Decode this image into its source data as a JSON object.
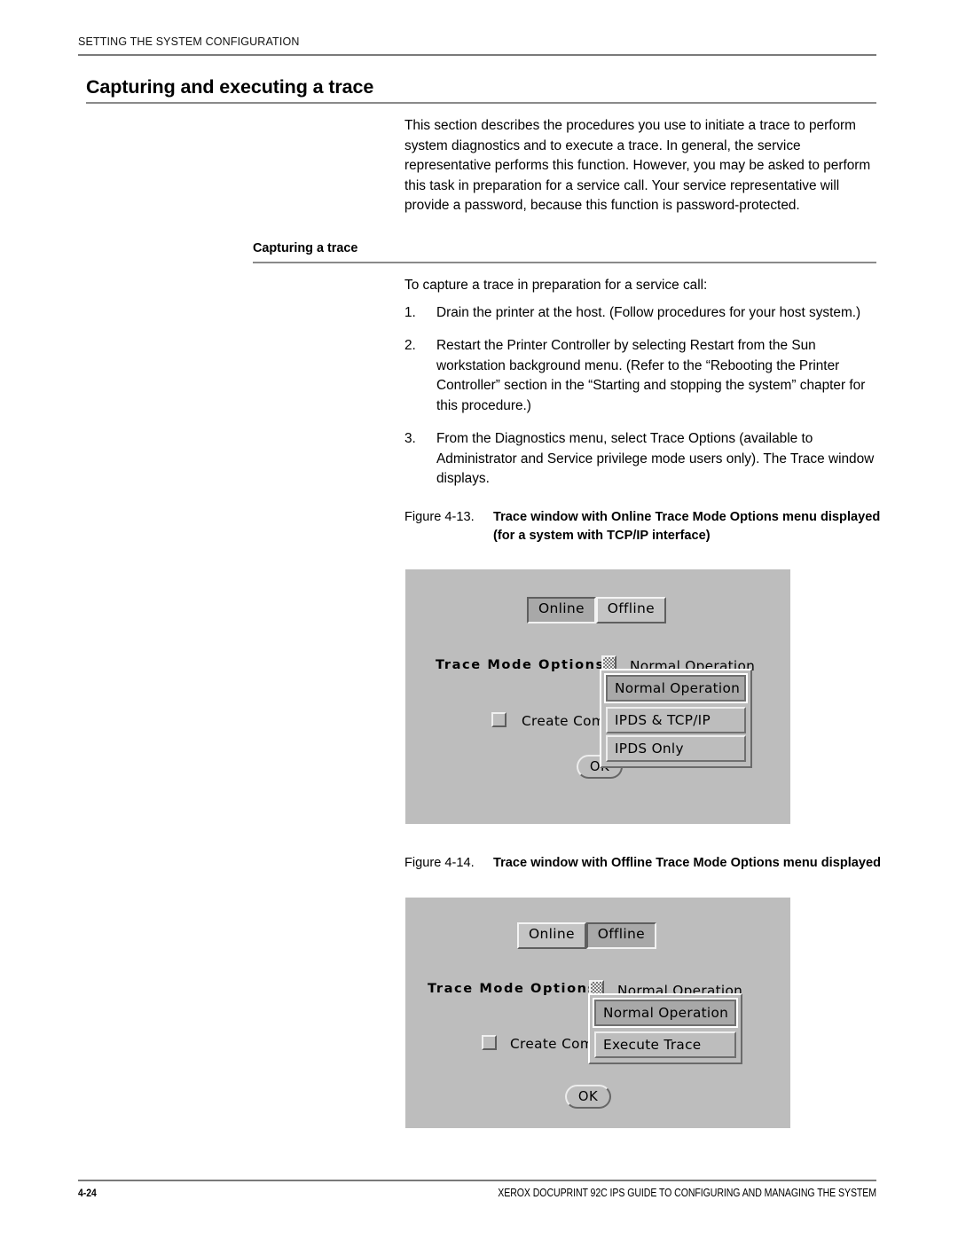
{
  "running_header": "SETTING THE SYSTEM CONFIGURATION",
  "chapter_title": "Capturing and executing a trace",
  "intro_paragraph": "This section describes the procedures you use to initiate a trace to perform system diagnostics and to execute a trace. In general, the service representative performs this function. However, you may be asked to perform this task in preparation for a service call. Your service representative will provide a password, because this function is password-protected.",
  "section": {
    "heading": "Capturing a trace",
    "lead_in": "To capture a trace in preparation for a service call:",
    "steps": [
      {
        "number": "1.",
        "text": "Drain the printer at the host. (Follow procedures for your host system.)"
      },
      {
        "number": "2.",
        "text": "Restart the Printer Controller by selecting Restart from the Sun workstation background menu. (Refer to the “Rebooting the Printer Controller” section in the “Starting and stopping the system” chapter for this procedure.)"
      },
      {
        "number": "3.",
        "text": "From the Diagnostics menu, select Trace Options (available to Administrator and Service privilege mode users only). The Trace window displays."
      }
    ]
  },
  "figure_13": {
    "number": "Figure 4-13.",
    "title": "Trace window with Online Trace Mode Options menu displayed (for a system with TCP/IP interface)",
    "screenshot": {
      "mode_toggle": {
        "online_label": "Online",
        "offline_label": "Offline",
        "selected": "Online"
      },
      "trace_mode_options_label": "Trace Mode Options",
      "menu_glyph": "dotted-menu-icon",
      "selected_value": "Normal Operation",
      "checkbox_label": "Create Com",
      "checkbox_checked": false,
      "menu_items": [
        {
          "label": "Normal Operation",
          "active": true
        },
        {
          "label": "IPDS & TCP/IP",
          "active": false
        },
        {
          "label": "IPDS Only",
          "active": false
        }
      ],
      "ok_label": "OK"
    }
  },
  "figure_14": {
    "number": "Figure 4-14.",
    "title": "Trace window with Offline Trace Mode Options menu displayed",
    "screenshot": {
      "mode_toggle": {
        "online_label": "Online",
        "offline_label": "Offline",
        "selected": "Offline"
      },
      "trace_mode_options_label": "Trace Mode Options",
      "menu_glyph": "dotted-menu-icon",
      "selected_value": "Normal Operation",
      "checkbox_label": "Create Com",
      "checkbox_checked": false,
      "menu_items": [
        {
          "label": "Normal Operation",
          "active": true
        },
        {
          "label": "Execute Trace",
          "active": false
        }
      ],
      "ok_label": "OK"
    }
  },
  "footer": {
    "page_number": "4-24",
    "title": "XEROX DOCUPRINT 92C IPS GUIDE TO CONFIGURING AND MANAGING THE SYSTEM"
  },
  "colors": {
    "panel_bg": "#bdbdbd",
    "rule": "#7a7a7a",
    "bevel_light": "#ffffff",
    "bevel_dark": "#646464",
    "selected_fill": "#a8a8a8"
  }
}
